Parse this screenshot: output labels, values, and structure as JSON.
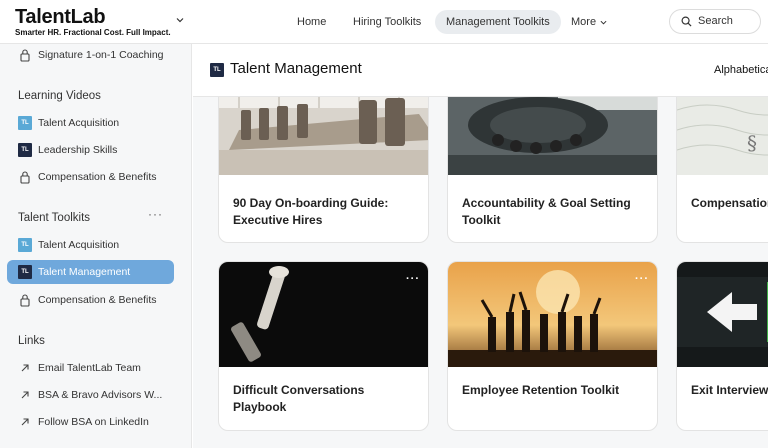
{
  "brand": {
    "name": "TalentLab",
    "tagline": "Smarter HR. Fractional Cost. Full Impact."
  },
  "nav": {
    "items": [
      {
        "label": "Home"
      },
      {
        "label": "Hiring Toolkits"
      },
      {
        "label": "Management Toolkits"
      },
      {
        "label": "More"
      }
    ],
    "active": "Management Toolkits",
    "search_label": "Search"
  },
  "sidebar": {
    "top_item": {
      "label": "Signature 1-on-1 Coaching",
      "icon": "lock-icon"
    },
    "sections": [
      {
        "heading": "Learning Videos",
        "items": [
          {
            "label": "Talent Acquisition",
            "icon": "tl-light"
          },
          {
            "label": "Leadership Skills",
            "icon": "tl-dark"
          },
          {
            "label": "Compensation & Benefits",
            "icon": "lock-icon"
          }
        ]
      },
      {
        "heading": "Talent Toolkits",
        "items": [
          {
            "label": "Talent Acquisition",
            "icon": "tl-light"
          },
          {
            "label": "Talent Management",
            "icon": "tl-dark",
            "active": true
          },
          {
            "label": "Compensation & Benefits",
            "icon": "lock-icon"
          }
        ]
      },
      {
        "heading": "Links",
        "items": [
          {
            "label": "Email TalentLab Team",
            "icon": "arrow-icon"
          },
          {
            "label": "BSA & Bravo Advisors W...",
            "icon": "arrow-icon"
          },
          {
            "label": "Follow BSA on LinkedIn",
            "icon": "arrow-icon"
          }
        ]
      }
    ],
    "badge_text": "TL",
    "section_menu": "···"
  },
  "main": {
    "title": "Talent Management",
    "sort_label": "Alphabetica",
    "cards": [
      {
        "title": "90 Day On-boarding Guide: Executive Hires",
        "image": "boardroom"
      },
      {
        "title": "Accountability & Goal Setting Toolkit",
        "image": "typewriter"
      },
      {
        "title": "Compensation",
        "image": "paper"
      },
      {
        "title": "Difficult Conversations Playbook",
        "image": "chess"
      },
      {
        "title": "Employee Retention Toolkit",
        "image": "sunset-team"
      },
      {
        "title": "Exit Interview Checklist",
        "image": "exit-sign"
      }
    ],
    "card_menu": "···"
  },
  "colors": {
    "active_item": "#6fa8dc",
    "badge_light": "#5aa9d6",
    "badge_dark": "#1f2a44",
    "nav_active_bg": "#e9ecef"
  }
}
